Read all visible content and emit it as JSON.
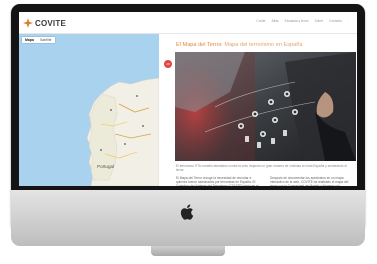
{
  "header": {
    "logo_text": "COVITE",
    "nav": [
      "Covite",
      "Atlas",
      "Escalada y terror",
      "Sobre",
      "Contacto",
      "·"
    ]
  },
  "map": {
    "tabs": [
      "Mapa",
      "Satélite"
    ],
    "country_label": "Portugal",
    "close_label": "28"
  },
  "article": {
    "title_main": "El Mapa del Terror.",
    "title_sub": " Mapa del terrorismo en España",
    "caption": "El terrorismo ETA cometió atentados contra la vida, dejando un gran número de víctimas en toda España y sembrando el terror.",
    "col1": "El Mapa del Terror recoge la necesidad de recordar a quienes fueron asesinados por terroristas en España. El Colectivo de Víctimas del Terrorismo (COVITE) inicia en el mes de 2016 este proyecto.",
    "col2": "Después de documentar los asesinatos en un mapa interactivo de la web, COVITE ha realizado el mapa del terror con la Comunidad de Madrid y Navarra y la Comunidad Valenciana y Andalucía."
  },
  "colors": {
    "accent": "#e08a3a",
    "map_water": "#a9d2ef",
    "map_land": "#f1efe6",
    "bezel": "#141414",
    "marker": "#e04545"
  },
  "icons": [
    "covite-logo-icon",
    "apple-logo-icon",
    "close-icon"
  ]
}
